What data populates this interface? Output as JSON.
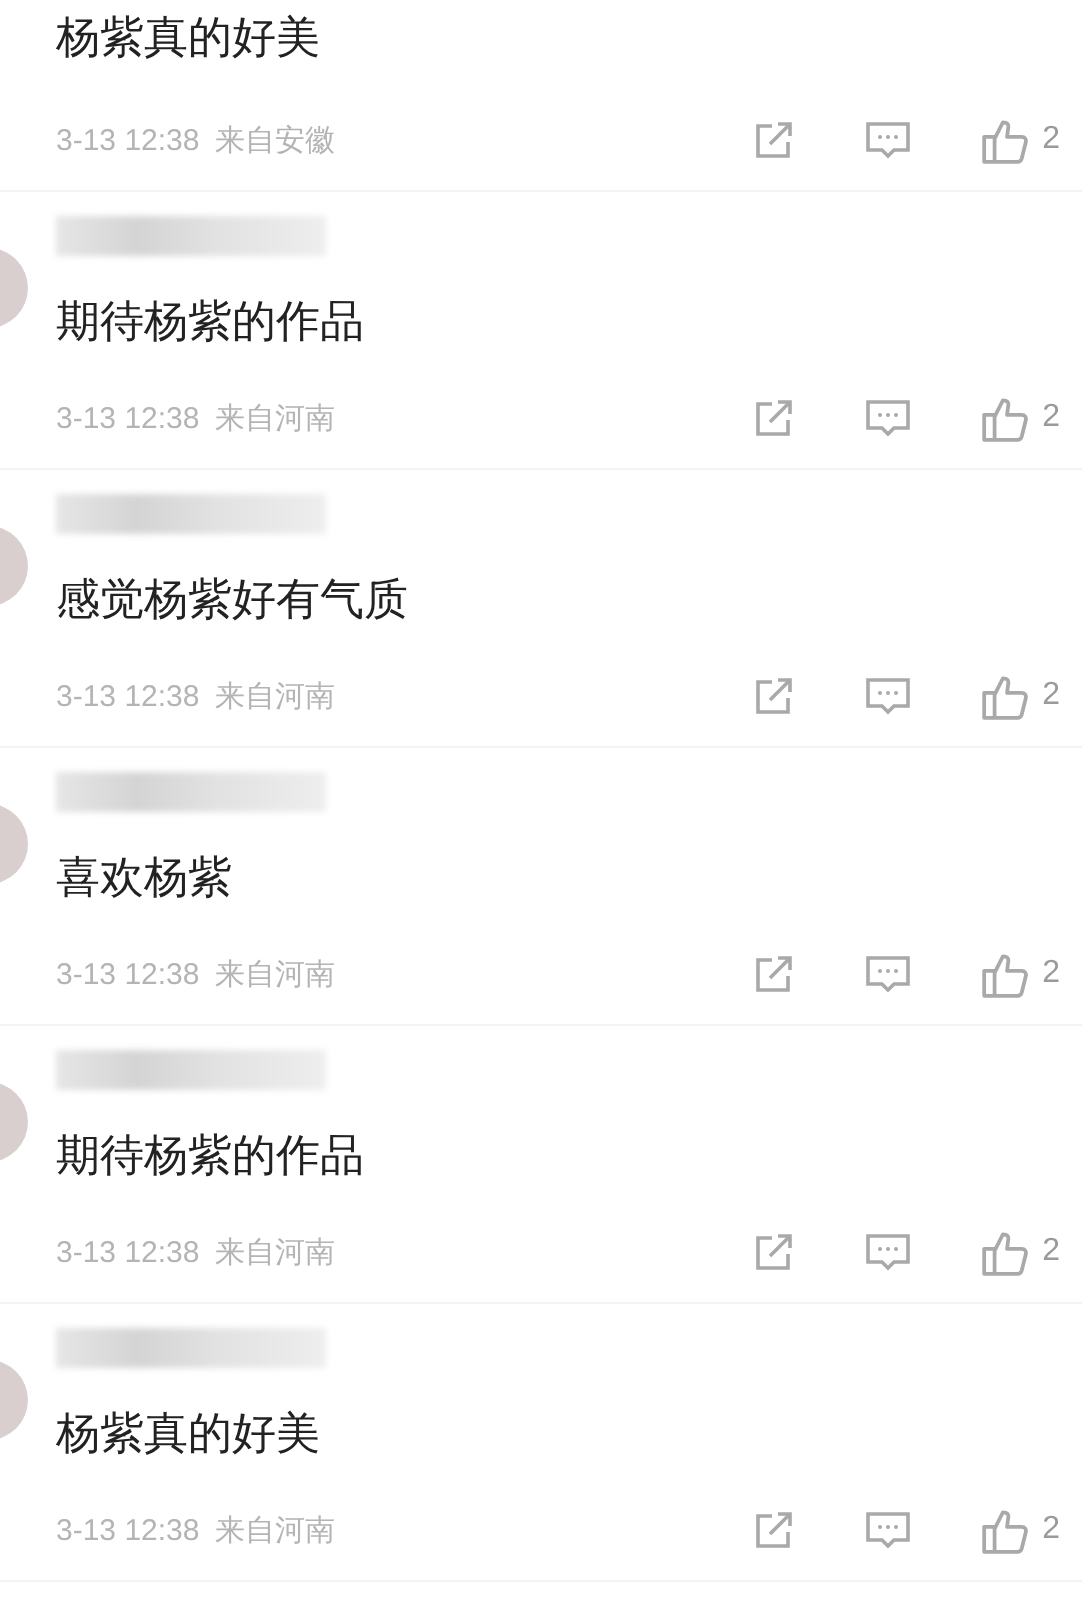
{
  "comments": [
    {
      "author_redacted": false,
      "text": "杨紫真的好美",
      "time": "3-13 12:38",
      "location": "来自安徽",
      "likes": "2"
    },
    {
      "author_redacted": true,
      "text": "期待杨紫的作品",
      "time": "3-13 12:38",
      "location": "来自河南",
      "likes": "2"
    },
    {
      "author_redacted": true,
      "text": "感觉杨紫好有气质",
      "time": "3-13 12:38",
      "location": "来自河南",
      "likes": "2"
    },
    {
      "author_redacted": true,
      "text": "喜欢杨紫",
      "time": "3-13 12:38",
      "location": "来自河南",
      "likes": "2"
    },
    {
      "author_redacted": true,
      "text": "期待杨紫的作品",
      "time": "3-13 12:38",
      "location": "来自河南",
      "likes": "2"
    },
    {
      "author_redacted": true,
      "text": "杨紫真的好美",
      "time": "3-13 12:38",
      "location": "来自河南",
      "likes": "2"
    }
  ]
}
